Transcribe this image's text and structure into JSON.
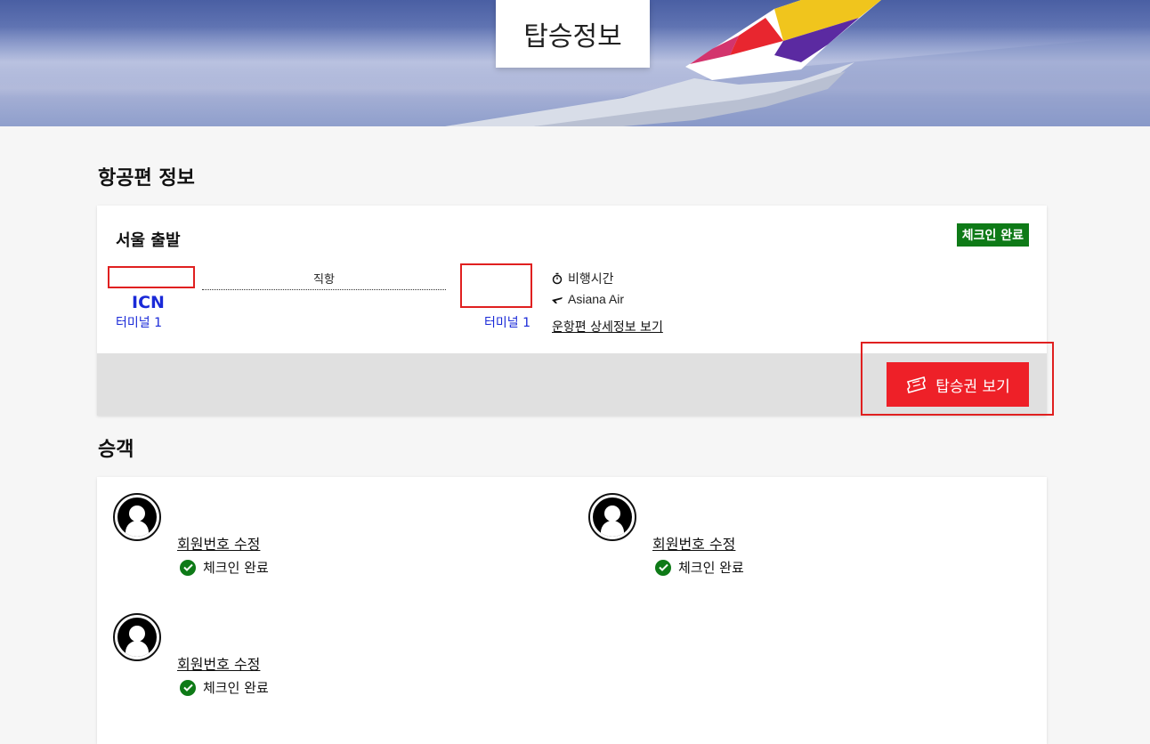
{
  "page": {
    "title": "탑승정보"
  },
  "flight_section": {
    "title": "항공편 정보",
    "departure_city_label": "서울 출발",
    "status_badge": "체크인 완료",
    "origin": {
      "code": "ICN",
      "terminal": "터미널 1"
    },
    "destination": {
      "terminal": "터미널 1"
    },
    "route_type": "직항",
    "flight_time_label": "비행시간",
    "airline": "Asiana Air",
    "detail_link": "운항편 상세정보 보기",
    "boarding_pass_button": "탑승권 보기"
  },
  "passenger_section": {
    "title": "승객",
    "passengers": [
      {
        "edit_link": "회원번호 수정",
        "status": "체크인 완료"
      },
      {
        "edit_link": "회원번호 수정",
        "status": "체크인 완료"
      },
      {
        "edit_link": "회원번호 수정",
        "status": "체크인 완료"
      }
    ]
  },
  "colors": {
    "badge_green": "#0e7a17",
    "button_red": "#ee2028",
    "airport_blue": "#1a2ad8",
    "highlight_red": "#e02020"
  }
}
